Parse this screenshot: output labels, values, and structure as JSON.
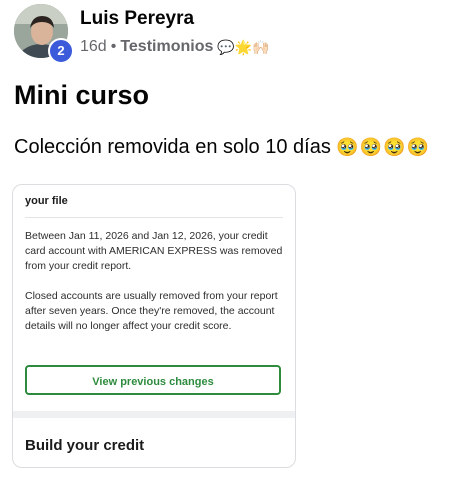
{
  "post": {
    "author": "Luis Pereyra",
    "avatar_badge": "2",
    "time": "16d",
    "separator": "•",
    "group": "Testimonios",
    "group_emojis": "💬🌟🙌🏻",
    "title": "Mini curso",
    "caption_text": "Colección removida en solo 10 días",
    "caption_emojis": "🥹🥹🥹🥹"
  },
  "card": {
    "heading": "your file",
    "paragraph1": "Between Jan 11, 2026 and Jan 12, 2026, your credit card account with AMERICAN EXPRESS was removed from your credit report.",
    "paragraph2": "Closed accounts are usually removed from your report after seven years. Once they're removed, the account details will no longer affect your credit score.",
    "button_label": "View previous changes",
    "section_title": "Build your credit",
    "accent_color": "#2e8b3e"
  },
  "icons": {
    "badge": "notification-count-badge"
  }
}
